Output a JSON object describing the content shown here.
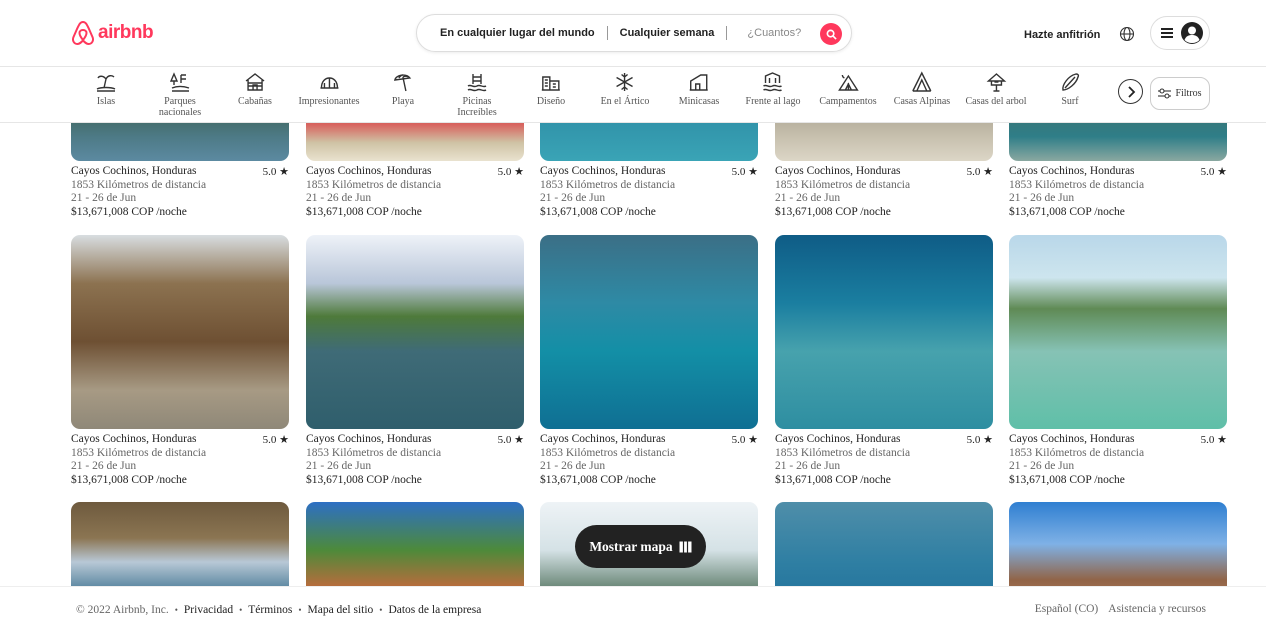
{
  "header": {
    "logo_text": "airbnb",
    "search": {
      "location": "En cualquier lugar del mundo",
      "week": "Cualquier semana",
      "guests": "¿Cuantos?"
    },
    "host_link": "Hazte anfitrión"
  },
  "categories": [
    {
      "label": "Islas",
      "icon": "island-icon"
    },
    {
      "label": "Parques nacionales",
      "icon": "national-park-icon"
    },
    {
      "label": "Cabañas",
      "icon": "cabin-icon"
    },
    {
      "label": "Impresionantes",
      "icon": "amazing-icon"
    },
    {
      "label": "Playa",
      "icon": "beach-icon"
    },
    {
      "label": "Picinas Increíbles",
      "icon": "pool-icon"
    },
    {
      "label": "Diseño",
      "icon": "design-icon"
    },
    {
      "label": "En el Ártico",
      "icon": "snowflake-icon"
    },
    {
      "label": "Minicasas",
      "icon": "tiny-house-icon"
    },
    {
      "label": "Frente al lago",
      "icon": "lake-icon"
    },
    {
      "label": "Campamentos",
      "icon": "camping-icon"
    },
    {
      "label": "Casas Alpinas",
      "icon": "a-frame-icon"
    },
    {
      "label": "Casas del arbol",
      "icon": "treehouse-icon"
    },
    {
      "label": "Surf",
      "icon": "surf-icon"
    }
  ],
  "filters_label": "Filtros",
  "listing": {
    "title": "Cayos Cochinos, Honduras",
    "rating": "5.0 ★",
    "distance": "1853 Kilómetros de distancia",
    "dates": "21 - 26 de Jun",
    "price": "$13,671,008 COP",
    "per_night": "/noche"
  },
  "map_button": "Mostrar mapa",
  "footer": {
    "copyright": "© 2022 Airbnb, Inc.",
    "links": [
      "Privacidad",
      "Términos",
      "Mapa del sitio",
      "Datos de la empresa"
    ],
    "language": "Español (CO)",
    "help": "Asistencia y recursos"
  },
  "colors": {
    "brand": "#ff385c",
    "text": "#222222",
    "muted": "#666666"
  }
}
